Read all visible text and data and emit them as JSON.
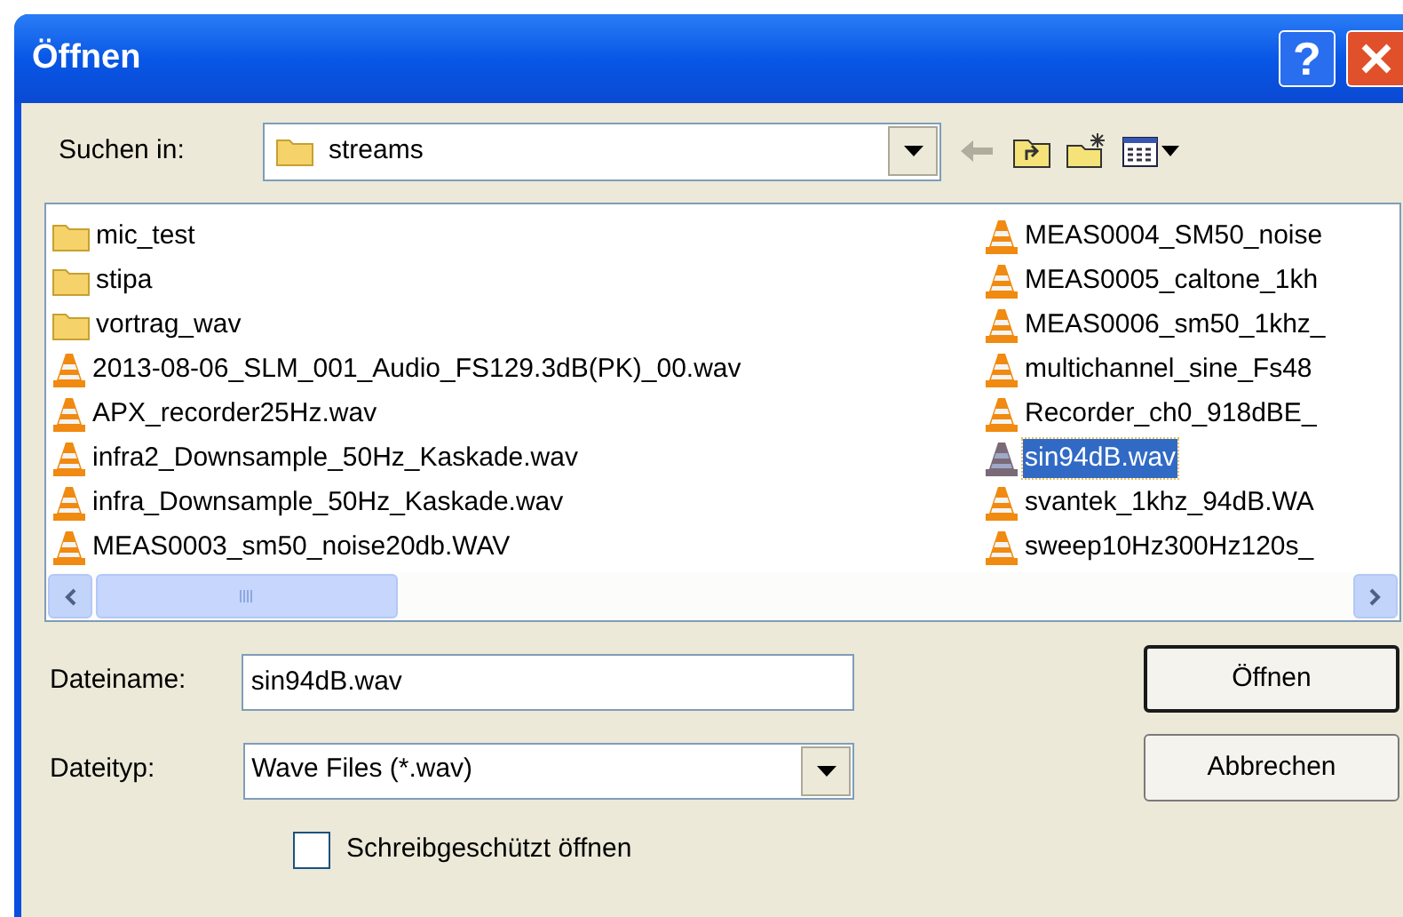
{
  "window": {
    "title": "Öffnen",
    "help": "?"
  },
  "look_in": {
    "label": "Suchen in:",
    "value": "streams"
  },
  "files": [
    {
      "kind": "folder",
      "name": "mic_test",
      "selected": false
    },
    {
      "kind": "folder",
      "name": "stipa",
      "selected": false
    },
    {
      "kind": "folder",
      "name": "vortrag_wav",
      "selected": false
    },
    {
      "kind": "file",
      "name": "2013-08-06_SLM_001_Audio_FS129.3dB(PK)_00.wav",
      "selected": false
    },
    {
      "kind": "file",
      "name": "APX_recorder25Hz.wav",
      "selected": false
    },
    {
      "kind": "file",
      "name": "infra2_Downsample_50Hz_Kaskade.wav",
      "selected": false
    },
    {
      "kind": "file",
      "name": "infra_Downsample_50Hz_Kaskade.wav",
      "selected": false
    },
    {
      "kind": "file",
      "name": "MEAS0003_sm50_noise20db.WAV",
      "selected": false
    },
    {
      "kind": "file",
      "name": "MEAS0004_SM50_noise",
      "selected": false
    },
    {
      "kind": "file",
      "name": "MEAS0005_caltone_1kh",
      "selected": false
    },
    {
      "kind": "file",
      "name": "MEAS0006_sm50_1khz_",
      "selected": false
    },
    {
      "kind": "file",
      "name": "multichannel_sine_Fs48",
      "selected": false
    },
    {
      "kind": "file",
      "name": "Recorder_ch0_918dBE_",
      "selected": false
    },
    {
      "kind": "file",
      "name": "sin94dB.wav",
      "selected": true
    },
    {
      "kind": "file",
      "name": "svantek_1khz_94dB.WA",
      "selected": false
    },
    {
      "kind": "file",
      "name": "sweep10Hz300Hz120s_",
      "selected": false
    }
  ],
  "file_name": {
    "label": "Dateiname:",
    "value": "sin94dB.wav"
  },
  "file_type": {
    "label": "Dateityp:",
    "value": "Wave Files (*.wav)"
  },
  "read_only": {
    "label": "Schreibgeschützt öffnen",
    "checked": false
  },
  "buttons": [
    {
      "label": "Öffnen",
      "default": true
    },
    {
      "label": "Abbrechen",
      "default": false
    }
  ]
}
